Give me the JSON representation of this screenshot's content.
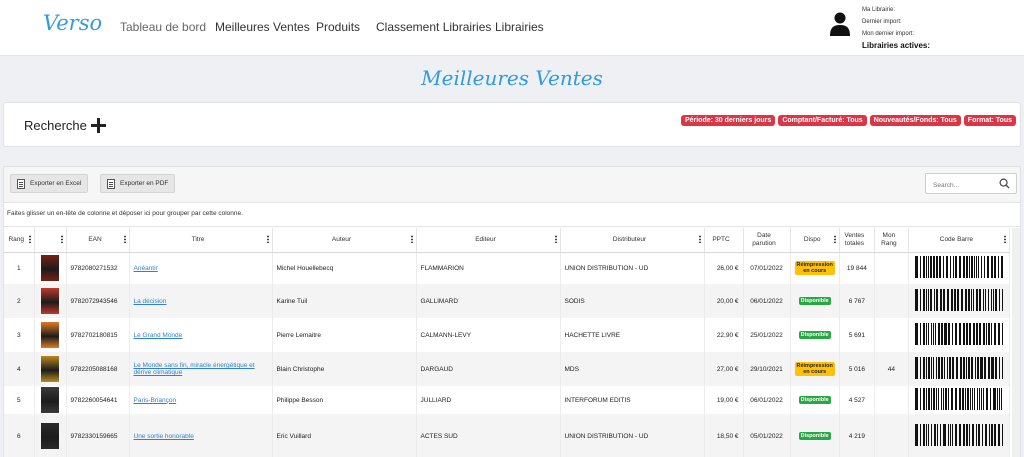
{
  "app": {
    "logo": "Verso",
    "nav": [
      "Tableau de bord",
      "Meilleures Ventes",
      "Produits",
      "Classement Librairies",
      "Librairies"
    ],
    "user": {
      "ma_librairie": "Ma Librairie:",
      "dernier_import": "Dernier import:",
      "mon_dernier_import": "Mon dernier import:",
      "librairies_actives": "Librairies actives:"
    }
  },
  "page": {
    "title": "Meilleures Ventes"
  },
  "search": {
    "label": "Recherche",
    "filters": [
      "Période: 30 derniers jours",
      "Comptant/Facturé: Tous",
      "Nouveautés/Fonds: Tous",
      "Format: Tous"
    ],
    "filter_color": "#dc3545"
  },
  "grid": {
    "export_excel": "Exporter en Excel",
    "export_pdf": "Exporter en PDF",
    "search_placeholder": "Search...",
    "group_hint": "Faites glisser un en-tête de colonne et déposer ici pour grouper par cette colonne.",
    "columns": [
      "Rang",
      "",
      "EAN",
      "Titre",
      "Auteur",
      "Editeur",
      "Distributeur",
      "PPTC",
      "Date parution",
      "Dispo",
      "Ventes totales",
      "Mon Rang",
      "Code Barre"
    ],
    "rows": [
      {
        "rang": "1",
        "ean": "9782080271532",
        "titre": "Anéantir",
        "auteur": "Michel Houellebecq",
        "editeur": "FLAMMARION",
        "distributeur": "UNION DISTRIBUTION - UD",
        "pptc": "26,00 €",
        "date": "07/01/2022",
        "dispo": "Réimpression en cours",
        "dispo_type": "yellow",
        "ventes": "19 844",
        "mon_rang": "",
        "cover_color": "#7a1f14"
      },
      {
        "rang": "2",
        "ean": "9782072943546",
        "titre": "La décision",
        "auteur": "Karine Tuil",
        "editeur": "GALLIMARD",
        "distributeur": "SODIS",
        "pptc": "20,00 €",
        "date": "06/01/2022",
        "dispo": "Disponible",
        "dispo_type": "green",
        "ventes": "6 767",
        "mon_rang": "",
        "cover_color": "#c0392b"
      },
      {
        "rang": "3",
        "ean": "9782702180815",
        "titre": "Le Grand Monde",
        "auteur": "Pierre Lemaitre",
        "editeur": "CALMANN-LEVY",
        "distributeur": "HACHETTE LIVRE",
        "pptc": "22,90 €",
        "date": "25/01/2022",
        "dispo": "Disponible",
        "dispo_type": "green",
        "ventes": "5 691",
        "mon_rang": "",
        "cover_color": "#e07b22"
      },
      {
        "rang": "4",
        "ean": "9782205088168",
        "titre": "Le Monde sans fin, miracle énergétique et dérive climatique",
        "auteur": "Blain Christophe",
        "editeur": "DARGAUD",
        "distributeur": "MDS",
        "pptc": "27,00 €",
        "date": "29/10/2021",
        "dispo": "Réimpression en cours",
        "dispo_type": "yellow",
        "ventes": "5 016",
        "mon_rang": "44",
        "cover_color": "#b88a1c"
      },
      {
        "rang": "5",
        "ean": "9782260054641",
        "titre": "Paris-Briançon",
        "auteur": "Philippe Besson",
        "editeur": "JULLIARD",
        "distributeur": "INTERFORUM EDITIS",
        "pptc": "19,00 €",
        "date": "06/01/2022",
        "dispo": "Disponible",
        "dispo_type": "green",
        "ventes": "4 527",
        "mon_rang": "",
        "cover_color": "#3a3a3a"
      },
      {
        "rang": "6",
        "ean": "9782330159665",
        "titre": "Une sortie honorable",
        "auteur": "Eric Vuillard",
        "editeur": "ACTES SUD",
        "distributeur": "UNION DISTRIBUTION - UD",
        "pptc": "18,50 €",
        "date": "05/01/2022",
        "dispo": "Disponible",
        "dispo_type": "green",
        "ventes": "4 219",
        "mon_rang": "",
        "cover_color": "#2b2b2b"
      }
    ]
  }
}
